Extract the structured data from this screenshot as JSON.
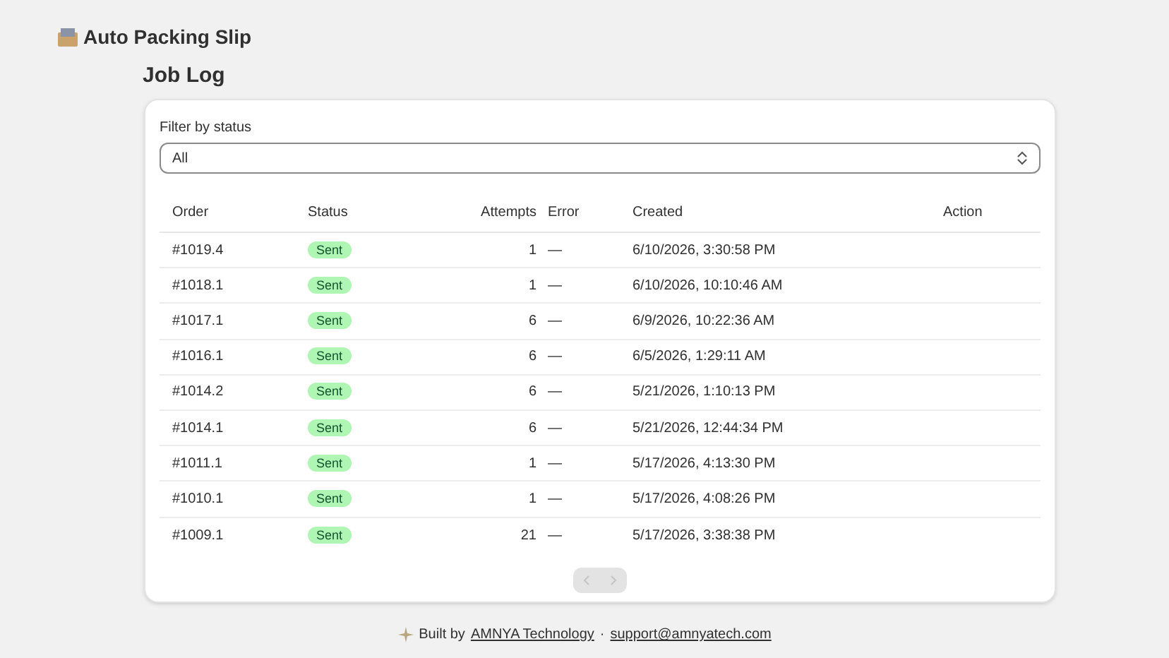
{
  "app_title": "Auto Packing Slip",
  "page_title": "Job Log",
  "filter": {
    "label": "Filter by status",
    "value": "All"
  },
  "table": {
    "columns": [
      "Order",
      "Status",
      "Attempts",
      "Error",
      "Created",
      "Action"
    ],
    "rows": [
      {
        "order": "#1019.4",
        "status": "Sent",
        "attempts": "1",
        "error": "—",
        "created": "6/10/2026, 3:30:58 PM"
      },
      {
        "order": "#1018.1",
        "status": "Sent",
        "attempts": "1",
        "error": "—",
        "created": "6/10/2026, 10:10:46 AM"
      },
      {
        "order": "#1017.1",
        "status": "Sent",
        "attempts": "6",
        "error": "—",
        "created": "6/9/2026, 10:22:36 AM"
      },
      {
        "order": "#1016.1",
        "status": "Sent",
        "attempts": "6",
        "error": "—",
        "created": "6/5/2026, 1:29:11 AM"
      },
      {
        "order": "#1014.2",
        "status": "Sent",
        "attempts": "6",
        "error": "—",
        "created": "5/21/2026, 1:10:13 PM"
      },
      {
        "order": "#1014.1",
        "status": "Sent",
        "attempts": "6",
        "error": "—",
        "created": "5/21/2026, 12:44:34 PM"
      },
      {
        "order": "#1011.1",
        "status": "Sent",
        "attempts": "1",
        "error": "—",
        "created": "5/17/2026, 4:13:30 PM"
      },
      {
        "order": "#1010.1",
        "status": "Sent",
        "attempts": "1",
        "error": "—",
        "created": "5/17/2026, 4:08:26 PM"
      },
      {
        "order": "#1009.1",
        "status": "Sent",
        "attempts": "21",
        "error": "—",
        "created": "5/17/2026, 3:38:38 PM"
      }
    ]
  },
  "pagination": {
    "previous_disabled": true,
    "next_disabled": true
  },
  "footer": {
    "prefix": "Built by",
    "company": "AMNYA Technology",
    "separator": "·",
    "email": "support@amnyatech.com"
  }
}
